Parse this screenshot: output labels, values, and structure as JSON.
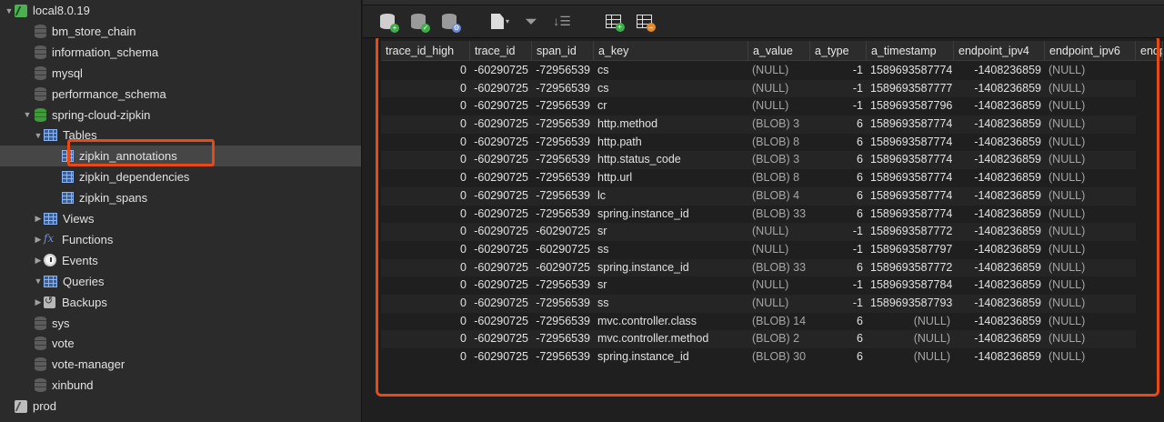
{
  "sidebar": {
    "items": [
      {
        "label": "local8.0.19",
        "icon": "connection-icon",
        "indent": 0,
        "arrow": "▼",
        "kind": "conn"
      },
      {
        "label": "bm_store_chain",
        "icon": "database-icon",
        "indent": 1,
        "arrow": "",
        "kind": "db"
      },
      {
        "label": "information_schema",
        "icon": "database-icon",
        "indent": 1,
        "arrow": "",
        "kind": "db"
      },
      {
        "label": "mysql",
        "icon": "database-icon",
        "indent": 1,
        "arrow": "",
        "kind": "db"
      },
      {
        "label": "performance_schema",
        "icon": "database-icon",
        "indent": 1,
        "arrow": "",
        "kind": "db"
      },
      {
        "label": "spring-cloud-zipkin",
        "icon": "database-icon",
        "indent": 1,
        "arrow": "▼",
        "kind": "db-green"
      },
      {
        "label": "Tables",
        "icon": "tables-icon",
        "indent": 2,
        "arrow": "▼",
        "kind": "grid"
      },
      {
        "label": "zipkin_annotations",
        "icon": "table-icon",
        "indent": 3,
        "arrow": "",
        "kind": "grid-small",
        "selected": true
      },
      {
        "label": "zipkin_dependencies",
        "icon": "table-icon",
        "indent": 3,
        "arrow": "",
        "kind": "grid-small"
      },
      {
        "label": "zipkin_spans",
        "icon": "table-icon",
        "indent": 3,
        "arrow": "",
        "kind": "grid-small"
      },
      {
        "label": "Views",
        "icon": "views-icon",
        "indent": 2,
        "arrow": "▶",
        "kind": "grid"
      },
      {
        "label": "Functions",
        "icon": "functions-icon",
        "indent": 2,
        "arrow": "▶",
        "kind": "fx"
      },
      {
        "label": "Events",
        "icon": "events-icon",
        "indent": 2,
        "arrow": "▶",
        "kind": "clock"
      },
      {
        "label": "Queries",
        "icon": "queries-icon",
        "indent": 2,
        "arrow": "▼",
        "kind": "grid"
      },
      {
        "label": "Backups",
        "icon": "backups-icon",
        "indent": 2,
        "arrow": "▶",
        "kind": "backup"
      },
      {
        "label": "sys",
        "icon": "database-icon",
        "indent": 1,
        "arrow": "",
        "kind": "db"
      },
      {
        "label": "vote",
        "icon": "database-icon",
        "indent": 1,
        "arrow": "",
        "kind": "db"
      },
      {
        "label": "vote-manager",
        "icon": "database-icon",
        "indent": 1,
        "arrow": "",
        "kind": "db"
      },
      {
        "label": "xinbund",
        "icon": "database-icon",
        "indent": 1,
        "arrow": "",
        "kind": "db"
      },
      {
        "label": "prod",
        "icon": "connection-icon",
        "indent": 0,
        "arrow": "",
        "kind": "conn-grey"
      }
    ]
  },
  "toolbar": {
    "buttons": [
      "new-database-icon",
      "open-database-icon",
      "database-settings-icon",
      "new-query-icon",
      "filter-icon",
      "sort-icon",
      "import-table-icon",
      "export-table-icon"
    ]
  },
  "table": {
    "columns": [
      "trace_id_high",
      "trace_id",
      "span_id",
      "a_key",
      "a_value",
      "a_type",
      "a_timestamp",
      "endpoint_ipv4",
      "endpoint_ipv6",
      "endp"
    ],
    "rows": [
      [
        "0",
        "-60290725",
        "-72956539",
        "cs",
        "(NULL)",
        "-1",
        "1589693587774",
        "-1408236859",
        "(NULL)"
      ],
      [
        "0",
        "-60290725",
        "-72956539",
        "cs",
        "(NULL)",
        "-1",
        "1589693587777",
        "-1408236859",
        "(NULL)"
      ],
      [
        "0",
        "-60290725",
        "-72956539",
        "cr",
        "(NULL)",
        "-1",
        "1589693587796",
        "-1408236859",
        "(NULL)"
      ],
      [
        "0",
        "-60290725",
        "-72956539",
        "http.method",
        "(BLOB) 3",
        "6",
        "1589693587774",
        "-1408236859",
        "(NULL)"
      ],
      [
        "0",
        "-60290725",
        "-72956539",
        "http.path",
        "(BLOB) 8",
        "6",
        "1589693587774",
        "-1408236859",
        "(NULL)"
      ],
      [
        "0",
        "-60290725",
        "-72956539",
        "http.status_code",
        "(BLOB) 3",
        "6",
        "1589693587774",
        "-1408236859",
        "(NULL)"
      ],
      [
        "0",
        "-60290725",
        "-72956539",
        "http.url",
        "(BLOB) 8",
        "6",
        "1589693587774",
        "-1408236859",
        "(NULL)"
      ],
      [
        "0",
        "-60290725",
        "-72956539",
        "lc",
        "(BLOB) 4",
        "6",
        "1589693587774",
        "-1408236859",
        "(NULL)"
      ],
      [
        "0",
        "-60290725",
        "-72956539",
        "spring.instance_id",
        "(BLOB) 33",
        "6",
        "1589693587774",
        "-1408236859",
        "(NULL)"
      ],
      [
        "0",
        "-60290725",
        "-60290725",
        "sr",
        "(NULL)",
        "-1",
        "1589693587772",
        "-1408236859",
        "(NULL)"
      ],
      [
        "0",
        "-60290725",
        "-60290725",
        "ss",
        "(NULL)",
        "-1",
        "1589693587797",
        "-1408236859",
        "(NULL)"
      ],
      [
        "0",
        "-60290725",
        "-60290725",
        "spring.instance_id",
        "(BLOB) 33",
        "6",
        "1589693587772",
        "-1408236859",
        "(NULL)"
      ],
      [
        "0",
        "-60290725",
        "-72956539",
        "sr",
        "(NULL)",
        "-1",
        "1589693587784",
        "-1408236859",
        "(NULL)"
      ],
      [
        "0",
        "-60290725",
        "-72956539",
        "ss",
        "(NULL)",
        "-1",
        "1589693587793",
        "-1408236859",
        "(NULL)"
      ],
      [
        "0",
        "-60290725",
        "-72956539",
        "mvc.controller.class",
        "(BLOB) 14",
        "6",
        "(NULL)",
        "-1408236859",
        "(NULL)"
      ],
      [
        "0",
        "-60290725",
        "-72956539",
        "mvc.controller.method",
        "(BLOB) 2",
        "6",
        "(NULL)",
        "-1408236859",
        "(NULL)"
      ],
      [
        "0",
        "-60290725",
        "-72956539",
        "spring.instance_id",
        "(BLOB) 30",
        "6",
        "(NULL)",
        "-1408236859",
        "(NULL)"
      ]
    ]
  },
  "colors": {
    "highlight": "#e74a16",
    "accent_green": "#3f9b3a"
  }
}
